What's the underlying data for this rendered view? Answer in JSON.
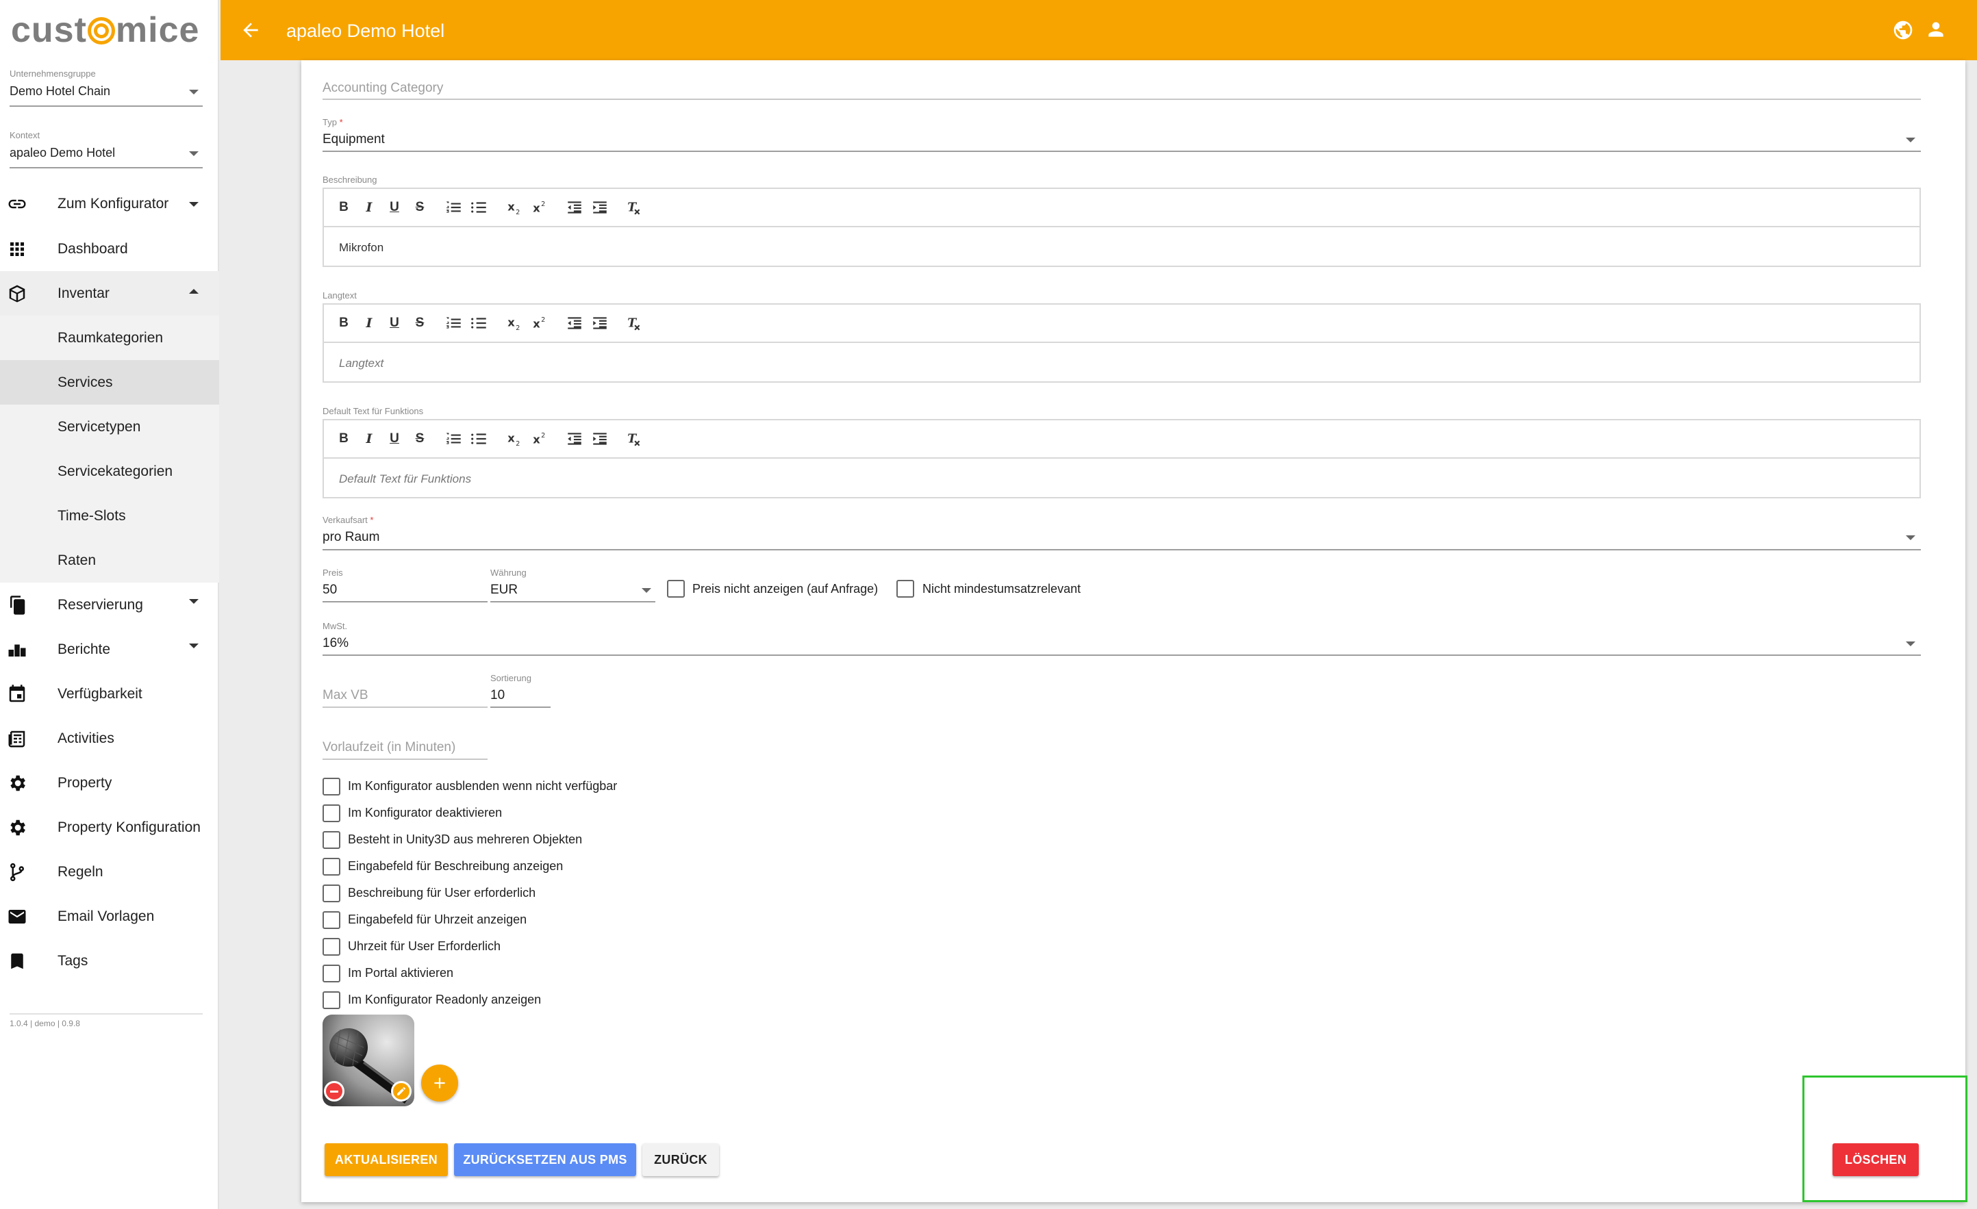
{
  "brand": {
    "logo_prefix": "cust",
    "logo_o": "o",
    "logo_suffix": "mice",
    "accent": "#f7a400"
  },
  "sidebar": {
    "group_label": "Unternehmensgruppe",
    "group_value": "Demo Hotel Chain",
    "context_label": "Kontext",
    "context_value": "apaleo Demo Hotel",
    "items": [
      {
        "label": "Zum Konfigurator",
        "icon": "link-icon"
      },
      {
        "label": "Dashboard",
        "icon": "grid-icon"
      },
      {
        "label": "Inventar",
        "icon": "cube-icon"
      },
      {
        "label": "Raumkategorien"
      },
      {
        "label": "Services"
      },
      {
        "label": "Servicetypen"
      },
      {
        "label": "Servicekategorien"
      },
      {
        "label": "Time-Slots"
      },
      {
        "label": "Raten"
      },
      {
        "label": "Reservierung",
        "icon": "copy-icon"
      },
      {
        "label": "Berichte",
        "icon": "bar-chart-icon"
      },
      {
        "label": "Verfügbarkeit",
        "icon": "calendar-icon"
      },
      {
        "label": "Activities",
        "icon": "newspaper-icon"
      },
      {
        "label": "Property",
        "icon": "gear-icon"
      },
      {
        "label": "Property Konfiguration",
        "icon": "gear-icon"
      },
      {
        "label": "Regeln",
        "icon": "fork-icon"
      },
      {
        "label": "Email Vorlagen",
        "icon": "mail-icon"
      },
      {
        "label": "Tags",
        "icon": "bookmark-icon"
      }
    ],
    "version": "1.0.4 | demo | 0.9.8"
  },
  "topbar": {
    "title": "apaleo Demo Hotel"
  },
  "form": {
    "accounting_category_placeholder": "Accounting Category",
    "typ_label": "Typ",
    "typ_value": "Equipment",
    "required_mark": "*",
    "beschreibung_label": "Beschreibung",
    "beschreibung_value": "Mikrofon",
    "langtext_label": "Langtext",
    "langtext_placeholder": "Langtext",
    "default_text_label": "Default Text für Funktions",
    "default_text_placeholder": "Default Text für Funktions",
    "verkaufsart_label": "Verkaufsart",
    "verkaufsart_value": "pro Raum",
    "preis_label": "Preis",
    "preis_value": "50",
    "waehrung_label": "Währung",
    "waehrung_value": "EUR",
    "preis_nicht_anzeigen": "Preis nicht anzeigen (auf Anfrage)",
    "nicht_mindestumsatz": "Nicht mindestumsatzrelevant",
    "mwst_label": "MwSt.",
    "mwst_value": "16%",
    "max_vb_placeholder": "Max VB",
    "sortierung_label": "Sortierung",
    "sortierung_value": "10",
    "vorlaufzeit_placeholder": "Vorlaufzeit (in Minuten)",
    "toolbar": [
      "B",
      "I",
      "U",
      "S",
      "ordered-list",
      "bullet-list",
      "subscript",
      "superscript",
      "outdent",
      "indent",
      "clear-format"
    ],
    "checkboxes": [
      "Im Konfigurator ausblenden wenn nicht verfügbar",
      "Im Konfigurator deaktivieren",
      "Besteht in Unity3D aus mehreren Objekten",
      "Eingabefeld für Beschreibung anzeigen",
      "Beschreibung für User erforderlich",
      "Eingabefeld für Uhrzeit anzeigen",
      "Uhrzeit für User Erforderlich",
      "Im Portal aktivieren",
      "Im Konfigurator Readonly anzeigen"
    ]
  },
  "buttons": {
    "update": "AKTUALISIEREN",
    "reset": "ZURÜCKSETZEN AUS PMS",
    "back": "ZURÜCK",
    "delete": "LÖSCHEN"
  }
}
